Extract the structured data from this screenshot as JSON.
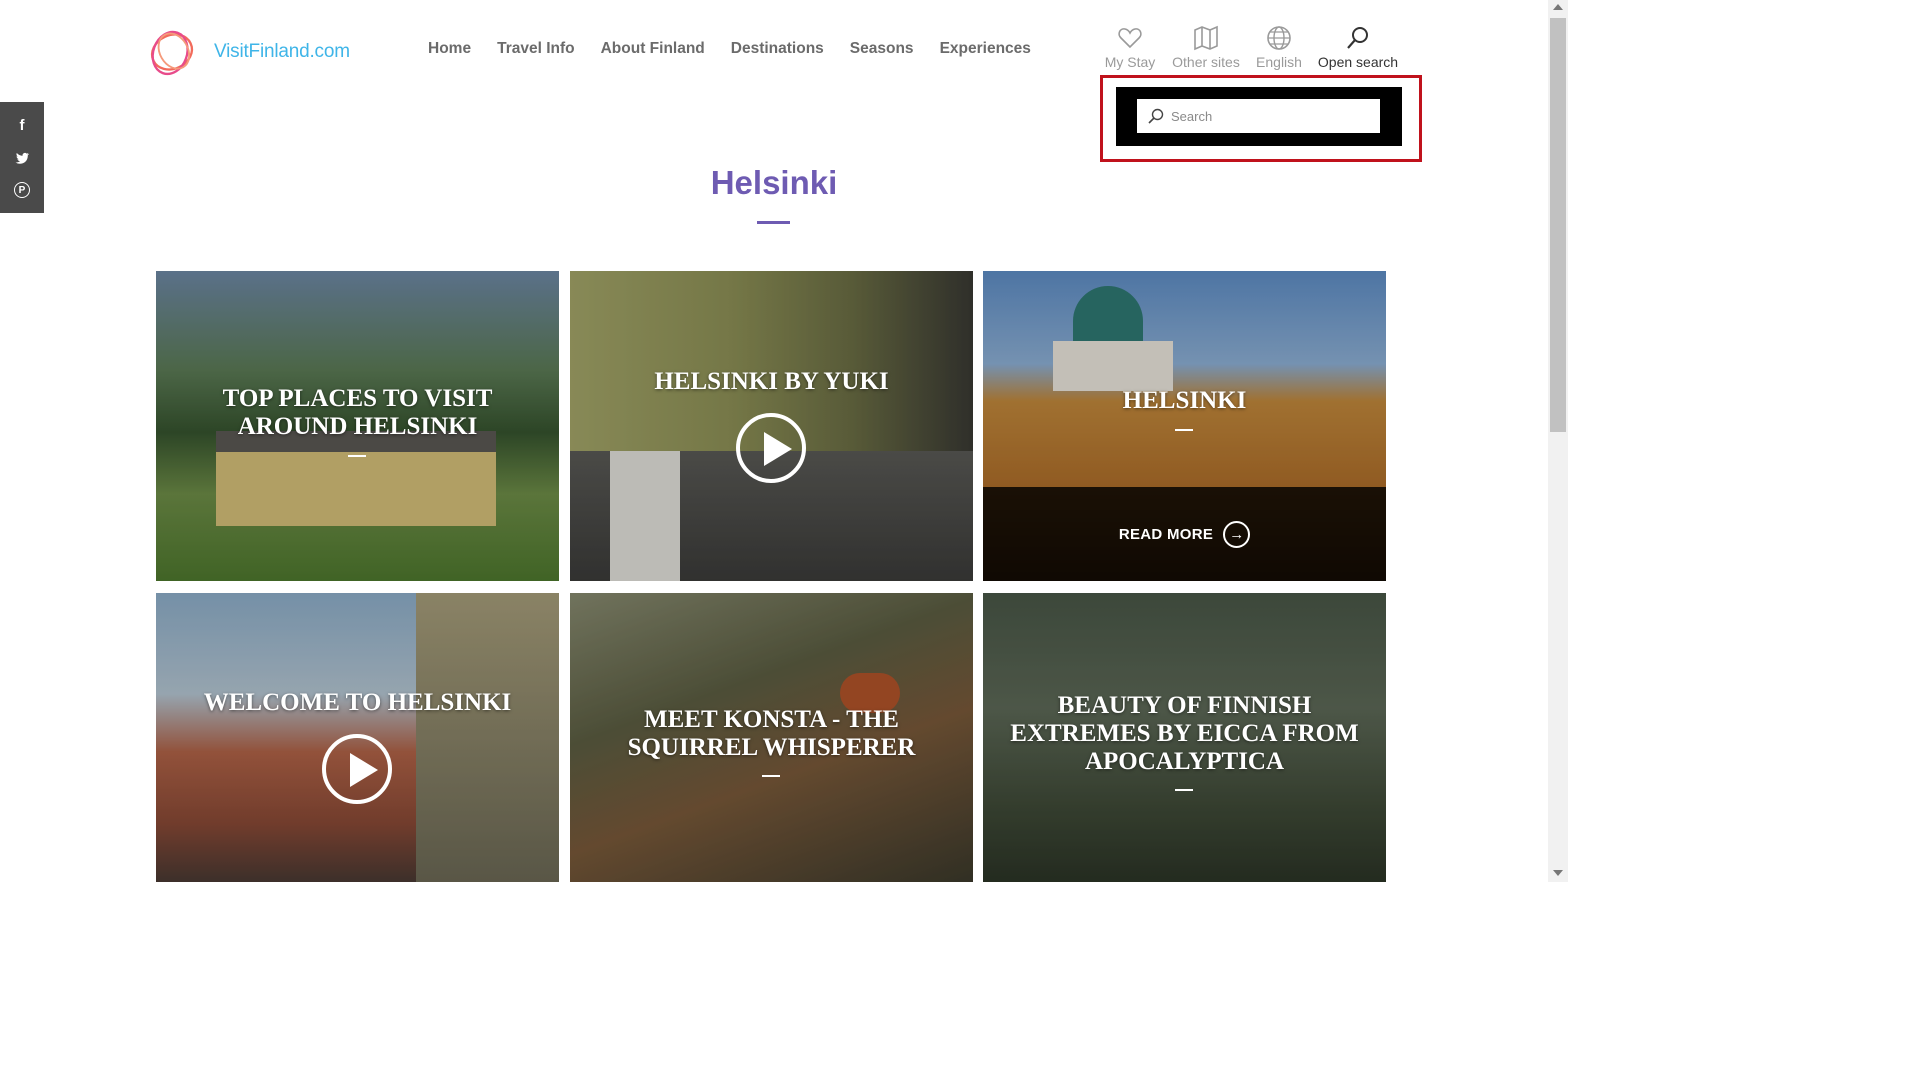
{
  "header": {
    "logo_text": "VisitFinland.com",
    "nav": [
      "Home",
      "Travel Info",
      "About Finland",
      "Destinations",
      "Seasons",
      "Experiences"
    ],
    "utilities": [
      {
        "label": "My Stay",
        "icon": "heart-icon"
      },
      {
        "label": "Other sites",
        "icon": "map-icon"
      },
      {
        "label": "English",
        "icon": "globe-icon"
      },
      {
        "label": "Open search",
        "icon": "search-icon"
      }
    ]
  },
  "search": {
    "placeholder": "Search",
    "value": ""
  },
  "social": [
    "facebook-icon",
    "twitter-icon",
    "pinterest-icon"
  ],
  "page": {
    "title": "Helsinki",
    "accent_color": "#6e5bb2"
  },
  "cards": [
    {
      "title": "Top places to visit around Helsinki",
      "video": false,
      "read_more": ""
    },
    {
      "title": "Helsinki by Yuki",
      "video": true,
      "read_more": ""
    },
    {
      "title": "Helsinki",
      "video": false,
      "read_more": "READ MORE"
    },
    {
      "title": "Welcome to Helsinki",
      "video": true,
      "read_more": ""
    },
    {
      "title": "Meet Konsta - the squirrel whisperer",
      "video": false,
      "read_more": ""
    },
    {
      "title": "Beauty of Finnish extremes by Eicca from Apocalyptica",
      "video": false,
      "read_more": ""
    }
  ]
}
